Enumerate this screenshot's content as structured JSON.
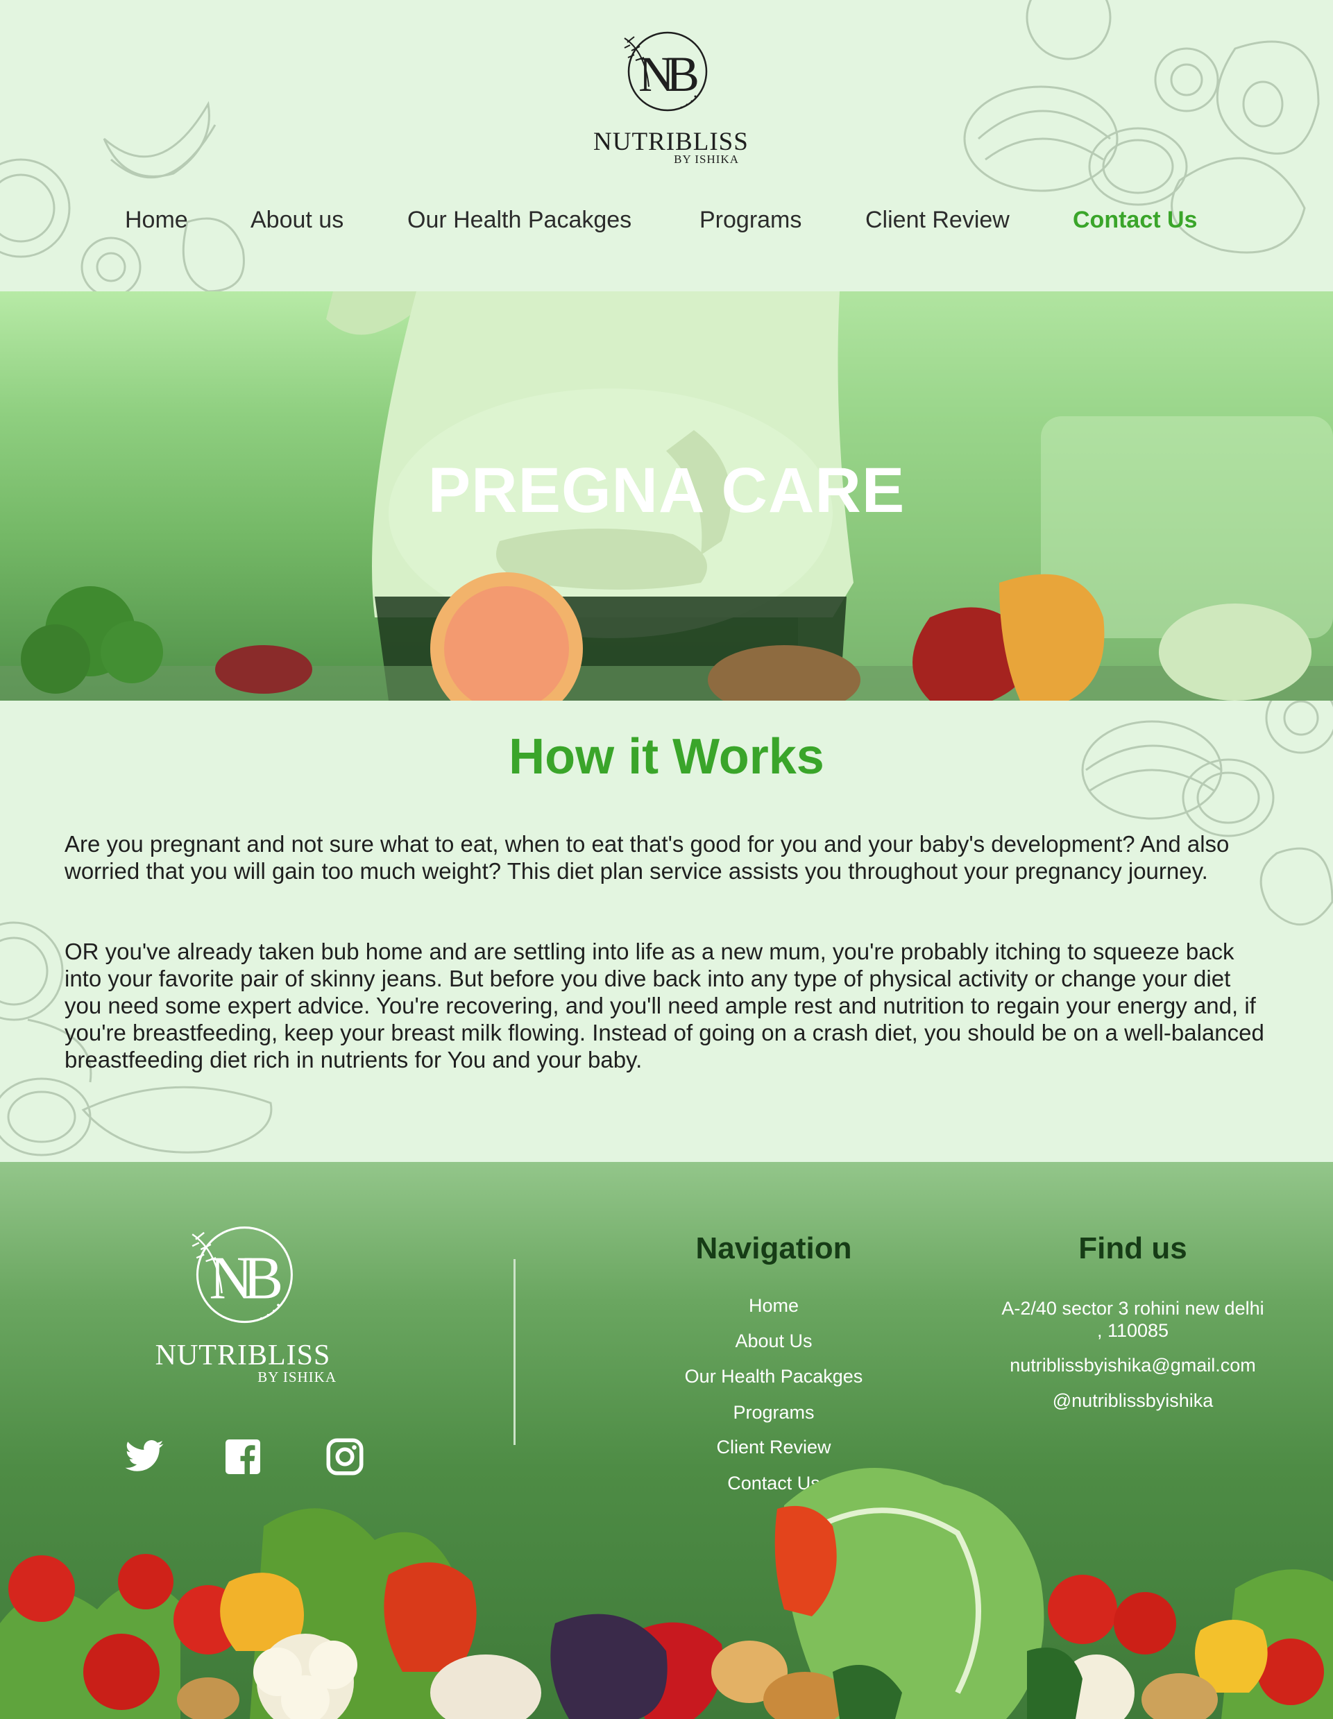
{
  "brand": {
    "name": "NUTRIBLISS",
    "sub": "BY ISHIKA",
    "mark_text": "NUTRIBLISS"
  },
  "nav": {
    "items": [
      {
        "label": "Home"
      },
      {
        "label": "About us"
      },
      {
        "label": "Our Health Pacakges"
      },
      {
        "label": "Programs"
      },
      {
        "label": "Client Review"
      },
      {
        "label": "Contact Us"
      }
    ],
    "active": "Contact Us"
  },
  "hero": {
    "title": "PREGNA CARE"
  },
  "how": {
    "title": "How it Works",
    "p1": "Are you pregnant and not sure what to eat, when to eat that's good for you and your baby's development? And also worried that you will gain too much weight? This diet plan service assists you throughout your pregnancy journey.",
    "p2": "OR you've already taken bub home and are settling into life as a new mum, you're probably itching to squeeze back into your favorite pair of skinny jeans. But before you dive back into any type of physical activity or change your diet you need some expert advice. You're recovering, and you'll need ample rest and nutrition to regain your energy and, if you're breastfeeding, keep your breast milk flowing. Instead of going on a crash diet, you should be on a well-balanced breastfeeding diet rich in nutrients for You and your baby."
  },
  "footer": {
    "navigation_title": "Navigation",
    "nav_items": [
      {
        "label": "Home"
      },
      {
        "label": "About Us"
      },
      {
        "label": "Our Health Pacakges"
      },
      {
        "label": "Programs"
      },
      {
        "label": "Client Review"
      },
      {
        "label": "Contact Us"
      }
    ],
    "find_title": "Find us",
    "address": "A-2/40 sector 3 rohini new delhi , 110085",
    "email": "nutriblissbyishika@gmail.com",
    "handle": "@nutriblissbyishika",
    "social": [
      "twitter-icon",
      "facebook-icon",
      "instagram-icon"
    ]
  },
  "colors": {
    "background": "#e3f5e0",
    "accent": "#3aa52a",
    "footer": "#4e8c45",
    "heading_dark": "#163c16"
  }
}
